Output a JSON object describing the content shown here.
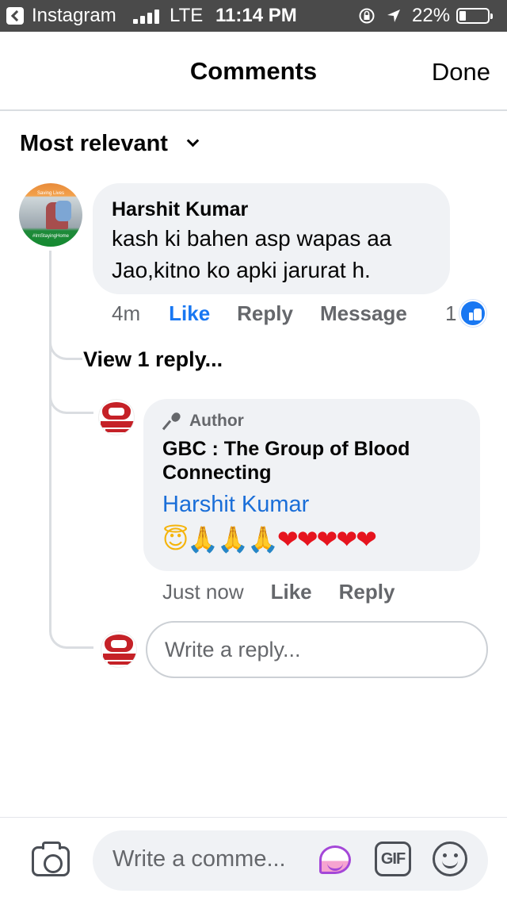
{
  "status_bar": {
    "app": "Instagram",
    "network": "LTE",
    "time": "11:14 PM",
    "battery": "22%"
  },
  "header": {
    "title": "Comments",
    "done": "Done"
  },
  "sort": {
    "label": "Most relevant"
  },
  "comment": {
    "author": "Harshit Kumar",
    "text_line1": "kash ki bahen asp wapas aa",
    "text_line2": "Jao,kitno ko apki jarurat h.",
    "time": "4m",
    "like": "Like",
    "reply": "Reply",
    "message": "Message",
    "reaction_count": "1",
    "avatar_top_text": "Saving Lives",
    "avatar_bottom_text": "#ImStayingHome"
  },
  "view_replies": "View 1 reply...",
  "reply": {
    "badge": "Author",
    "author_line1": "GBC : The Group of Blood",
    "author_line2": "Connecting",
    "mention": "Harshit Kumar",
    "emojis": {
      "halo": "😇",
      "pray": "🙏🙏🙏",
      "hearts": "❤❤❤❤❤"
    },
    "time": "Just now",
    "like": "Like",
    "reply": "Reply"
  },
  "reply_input": {
    "placeholder": "Write a reply..."
  },
  "composer": {
    "placeholder": "Write a comme...",
    "gif": "GIF"
  },
  "colors": {
    "accent": "#1877f2",
    "mention": "#1a6ed8",
    "bubble": "#f0f2f5",
    "status_bar": "#4a4a4a"
  }
}
